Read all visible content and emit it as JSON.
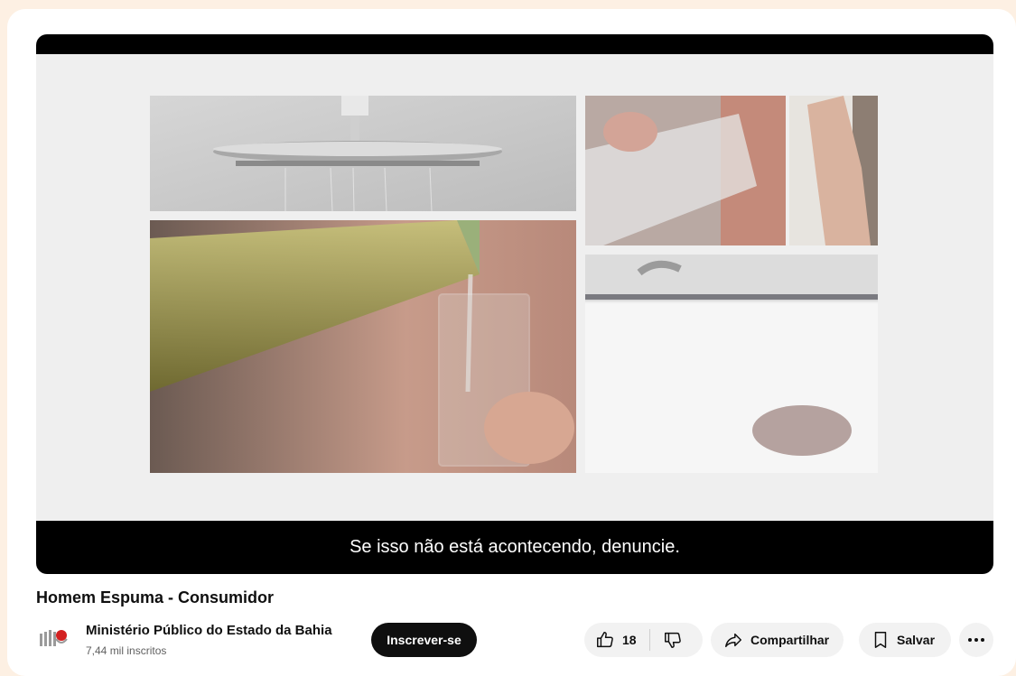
{
  "video": {
    "caption": "Se isso não está acontecendo, denuncie.",
    "title": "Homem Espuma - Consumidor"
  },
  "channel": {
    "name": "Ministério Público do Estado da Bahia",
    "subscribers": "7,44 mil inscritos",
    "logo_icon": "mp-bahia-logo"
  },
  "actions": {
    "subscribe_label": "Inscrever-se",
    "like_count": "18",
    "share_label": "Compartilhar",
    "save_label": "Salvar"
  },
  "icons": {
    "like": "thumbs-up-icon",
    "dislike": "thumbs-down-icon",
    "share": "share-arrow-icon",
    "save": "bookmark-icon",
    "more": "more-horizontal-icon"
  },
  "colors": {
    "background": "#fdf0e3",
    "subscribe_button": "#0f0f0f",
    "pill_button": "#f2f2f2",
    "player": "#000000"
  }
}
